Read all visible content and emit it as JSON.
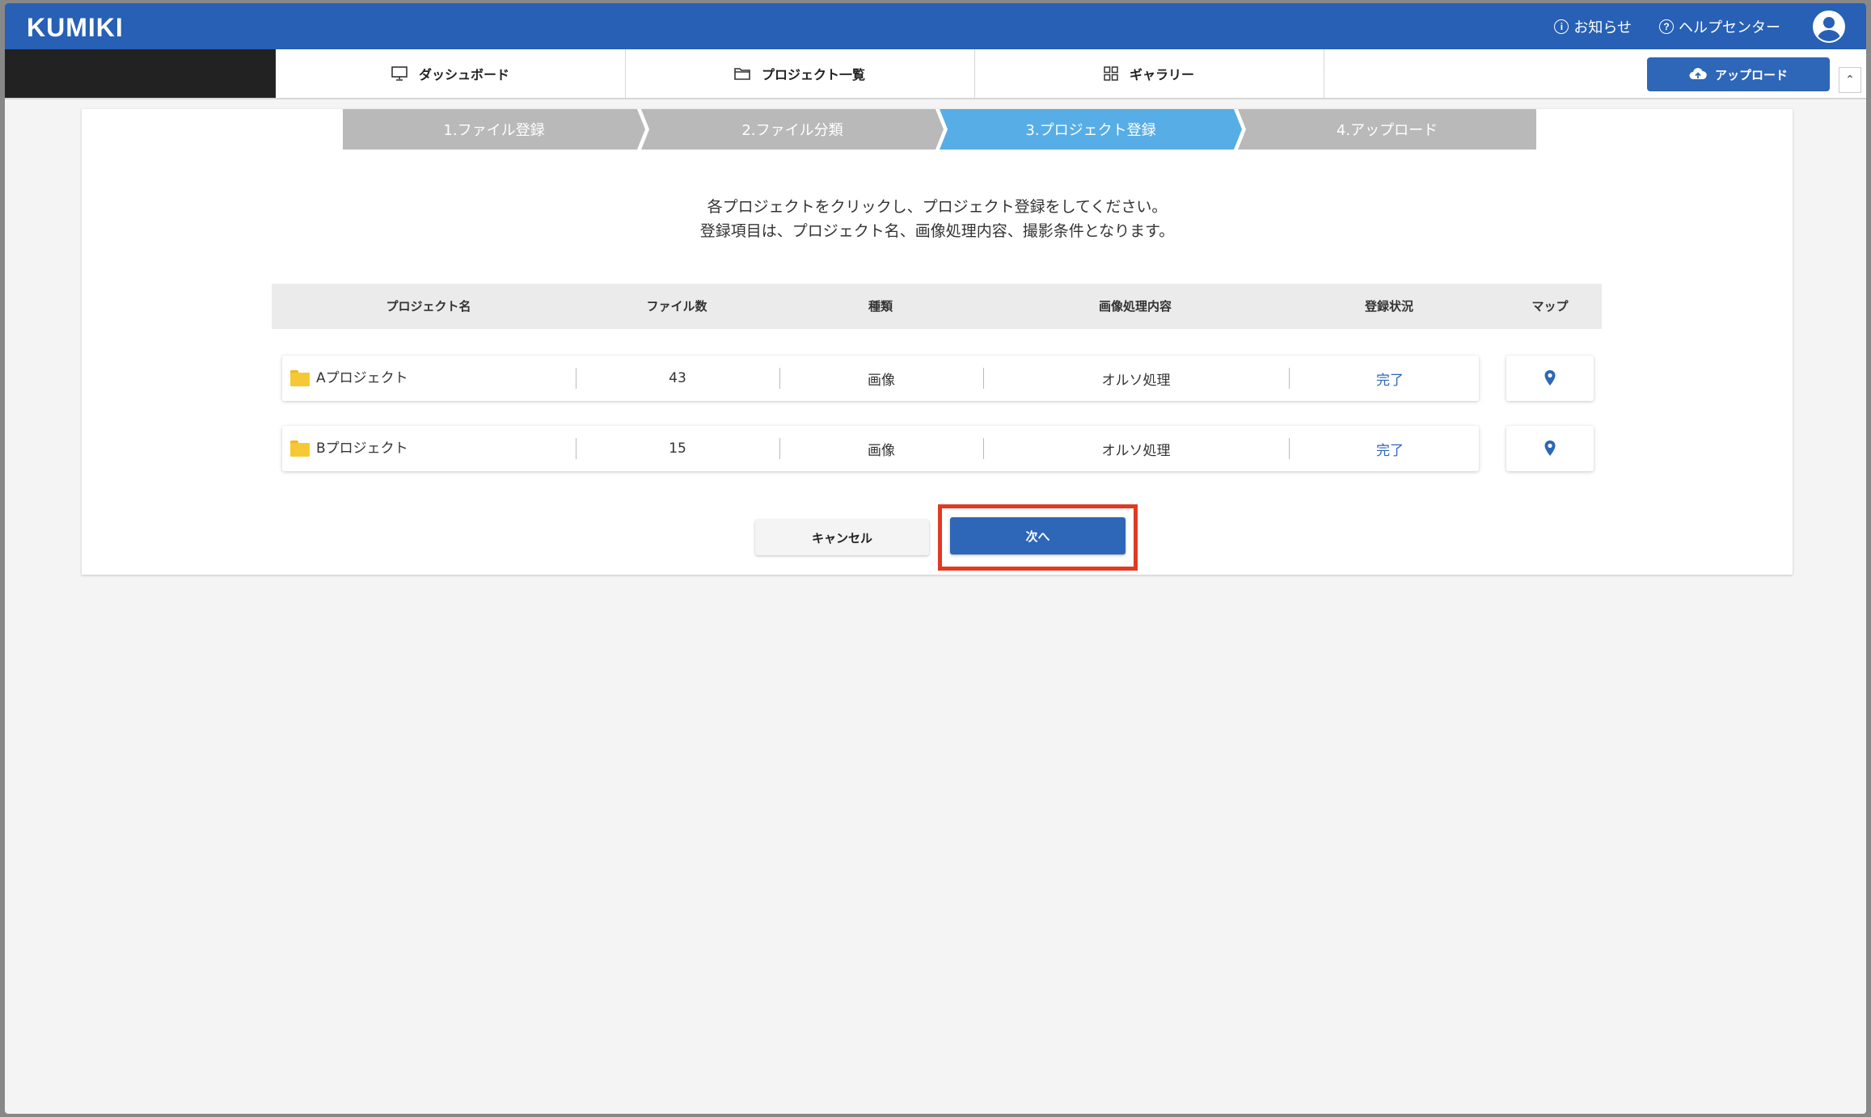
{
  "app": {
    "logo": "KUMIKI"
  },
  "topnav": {
    "notice_label": "お知らせ",
    "help_label": "ヘルプセンター"
  },
  "tabs": [
    {
      "label": "ダッシュボード",
      "icon": "monitor-icon"
    },
    {
      "label": "プロジェクト一覧",
      "icon": "folder-icon"
    },
    {
      "label": "ギャラリー",
      "icon": "grid-icon"
    }
  ],
  "upload_button": {
    "label": "アップロード",
    "icon": "cloud-upload-icon"
  },
  "steps": [
    {
      "label": "1.ファイル登録",
      "active": false
    },
    {
      "label": "2.ファイル分類",
      "active": false
    },
    {
      "label": "3.プロジェクト登録",
      "active": true
    },
    {
      "label": "4.アップロード",
      "active": false
    }
  ],
  "instructions": {
    "line1": "各プロジェクトをクリックし、プロジェクト登録をしてください。",
    "line2": "登録項目は、プロジェクト名、画像処理内容、撮影条件となります。"
  },
  "table": {
    "headers": {
      "name": "プロジェクト名",
      "files": "ファイル数",
      "type": "種類",
      "processing": "画像処理内容",
      "status": "登録状況",
      "map": "マップ"
    },
    "rows": [
      {
        "name": "Aプロジェクト",
        "files": "43",
        "type": "画像",
        "processing": "オルソ処理",
        "status": "完了"
      },
      {
        "name": "Bプロジェクト",
        "files": "15",
        "type": "画像",
        "processing": "オルソ処理",
        "status": "完了"
      }
    ]
  },
  "buttons": {
    "cancel": "キャンセル",
    "next": "次へ"
  },
  "colors": {
    "brand": "#2760b4",
    "active_step": "#57ade5",
    "highlight": "#e03a22"
  }
}
